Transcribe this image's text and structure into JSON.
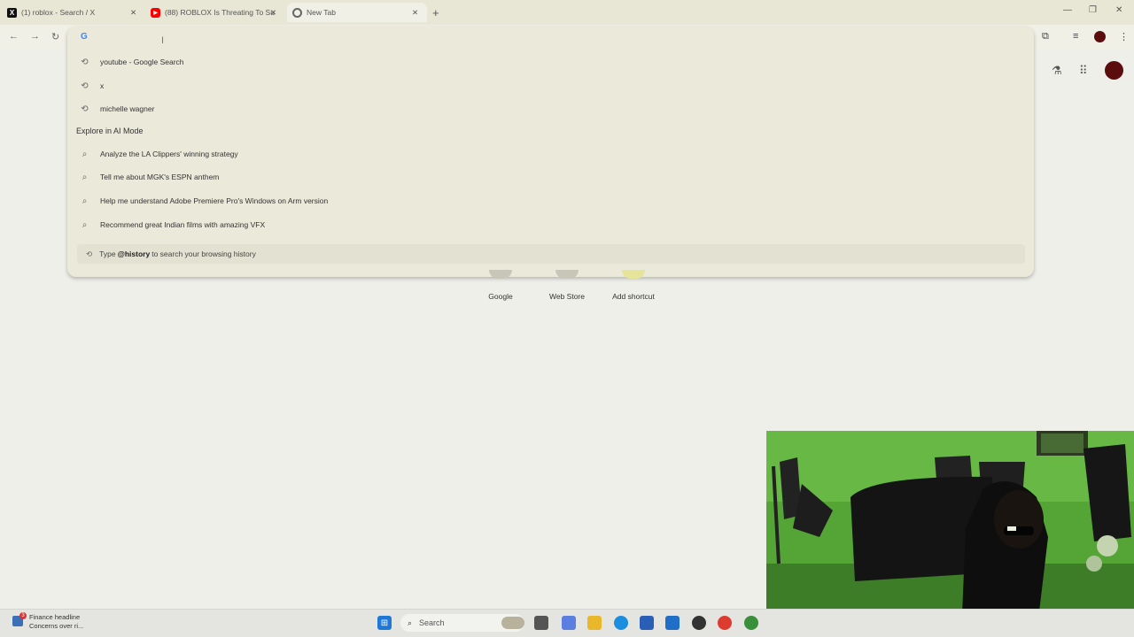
{
  "tabs": [
    {
      "title": "(1) roblox - Search / X",
      "icon": "x-logo-icon"
    },
    {
      "title": "(88) ROBLOX Is Threating To Su",
      "icon": "youtube-icon"
    },
    {
      "title": "New Tab",
      "icon": "chrome-icon"
    }
  ],
  "window_controls": {
    "minimize": "—",
    "maximize": "❐",
    "close": "✕"
  },
  "omnibox": {
    "history_suggestions": [
      {
        "text": "youtube - Google Search",
        "icon": "history-icon"
      },
      {
        "text": "x",
        "icon": "history-icon"
      },
      {
        "text": "michelle wagner",
        "icon": "history-icon"
      }
    ],
    "ai_section_title": "Explore in AI Mode",
    "ai_suggestions": [
      {
        "text": "Analyze the LA Clippers' winning strategy",
        "icon": "search-icon"
      },
      {
        "text": "Tell me about MGK's ESPN anthem",
        "icon": "search-icon"
      },
      {
        "text": "Help me understand Adobe Premiere Pro's Windows on Arm version",
        "icon": "search-icon"
      },
      {
        "text": "Recommend great Indian films with amazing VFX",
        "icon": "search-icon"
      }
    ],
    "history_tip_prefix": "Type",
    "history_tip_keyword": "@history",
    "history_tip_suffix": "to search your browsing history"
  },
  "shortcuts": [
    {
      "label": "Google"
    },
    {
      "label": "Web Store"
    },
    {
      "label": "Add shortcut"
    }
  ],
  "taskbar": {
    "weather_title": "Finance headline",
    "weather_sub": "Concerns over ri...",
    "weather_badge": "3",
    "search_placeholder": "Search"
  },
  "colors": {
    "accent": "#4285f4",
    "youtube": "#ff0000",
    "webcam_green": "#4e9a32"
  }
}
